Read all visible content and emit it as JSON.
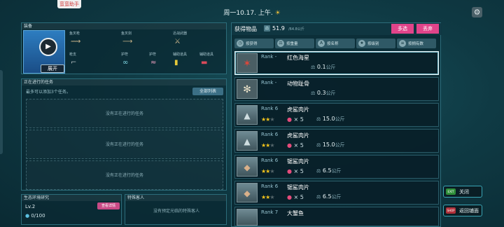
{
  "top_badge": "蛮蛮助手",
  "date": "周一10.17. 上午.",
  "equipment": {
    "header": "装备",
    "expand_label": "展开",
    "slots": [
      {
        "label": "鱼叉枪"
      },
      {
        "label": "鱼叉剑"
      },
      {
        "label": "近战武器"
      },
      {
        "label": "枪支"
      },
      {
        "label": "护符"
      },
      {
        "label": "护符"
      },
      {
        "label": "辅助道具"
      },
      {
        "label": "辅助道具"
      }
    ]
  },
  "tasks": {
    "header": "正在进行的任务",
    "hint": "最多可以添加3个任务。",
    "all_button": "全部列表",
    "empty_slots": [
      "没有正在进行的任务",
      "没有正在进行的任务",
      "没有正在进行的任务"
    ]
  },
  "eco": {
    "header": "生态环境研究",
    "level": "Lv.2",
    "detail_button": "查看详情",
    "exp": "0/100"
  },
  "special": {
    "header": "特殊客人",
    "empty": "没有预定光临的特殊客人"
  },
  "inventory": {
    "title": "获得物品",
    "capacity": "51.9",
    "capacity_max": "/64.8公斤",
    "multi_select": "多选",
    "discard": "丢弃",
    "sorts": [
      {
        "icon": "clock-icon",
        "label": "按获得"
      },
      {
        "icon": "weight-icon",
        "label": "按重量"
      },
      {
        "icon": "name-icon",
        "label": "按名称"
      },
      {
        "icon": "rank-icon",
        "label": "按级别"
      },
      {
        "icon": "type-icon",
        "label": "按拥有数"
      }
    ],
    "items": [
      {
        "rank": "Rank -",
        "name": "红色海星",
        "stars": null,
        "bait": null,
        "weight": "0.1",
        "unit": "公斤",
        "thumb": "✶",
        "selected": true
      },
      {
        "rank": "Rank -",
        "name": "动物趾骨",
        "stars": null,
        "bait": null,
        "weight": "0.3",
        "unit": "公斤",
        "thumb": "✻",
        "selected": false
      },
      {
        "rank": "Rank 6",
        "name": "虎鲨肉片",
        "stars": 2,
        "bait": "5",
        "weight": "15.0",
        "unit": "公斤",
        "thumb": "▲",
        "selected": false
      },
      {
        "rank": "Rank 6",
        "name": "虎鲨肉片",
        "stars": 2,
        "bait": "5",
        "weight": "15.0",
        "unit": "公斤",
        "thumb": "▲",
        "selected": false
      },
      {
        "rank": "Rank 6",
        "name": "锯鲨肉片",
        "stars": 2,
        "bait": "5",
        "weight": "6.5",
        "unit": "公斤",
        "thumb": "◆",
        "selected": false
      },
      {
        "rank": "Rank 6",
        "name": "锯鲨肉片",
        "stars": 2,
        "bait": "5",
        "weight": "6.5",
        "unit": "公斤",
        "thumb": "◆",
        "selected": false
      },
      {
        "rank": "Rank 7",
        "name": "大蟹鱼",
        "stars": null,
        "bait": null,
        "weight": "",
        "unit": "",
        "thumb": "",
        "selected": false
      }
    ]
  },
  "buttons": {
    "exit_icon": "EXIT",
    "close": "关闭",
    "shop_icon": "SHOP",
    "return_shop": "返回铺面"
  }
}
